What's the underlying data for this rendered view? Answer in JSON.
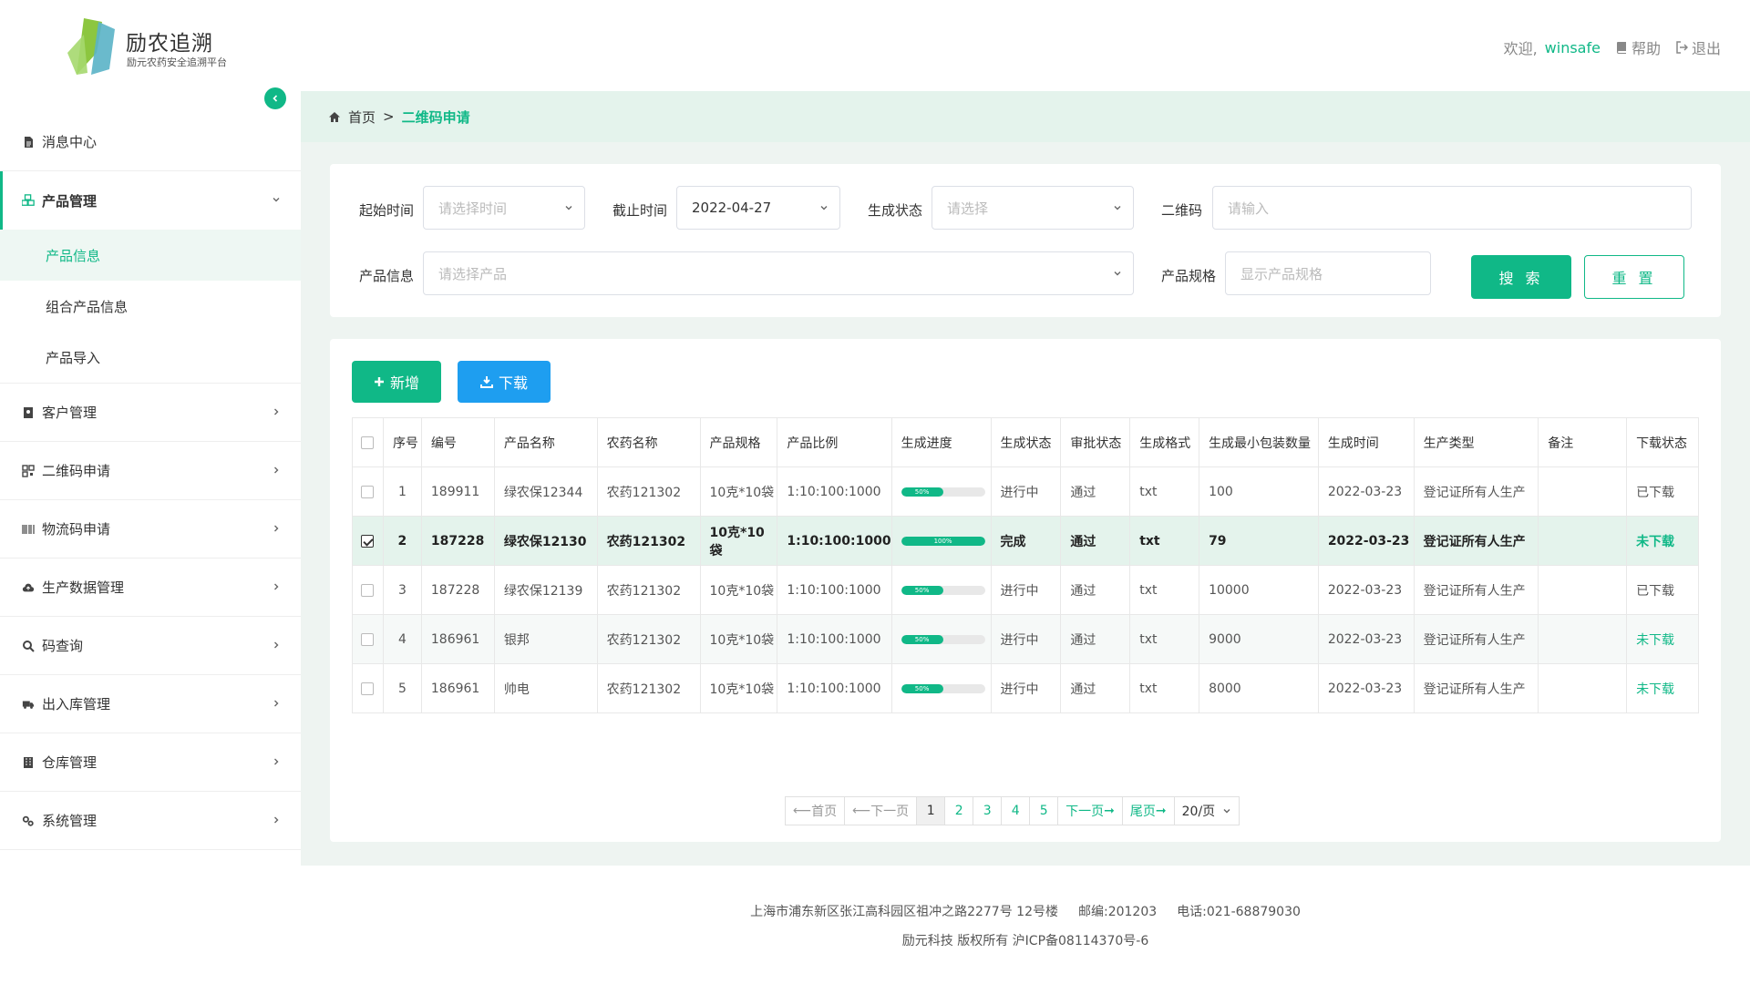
{
  "brand": {
    "title": "励农追溯",
    "subtitle": "励元农药安全追溯平台"
  },
  "header": {
    "welcome": "欢迎,",
    "username": "winsafe",
    "help": "帮助",
    "logout": "退出"
  },
  "sidebar": {
    "items": [
      {
        "label": "消息中心",
        "icon": "document-icon"
      },
      {
        "label": "产品管理",
        "icon": "cubes-icon",
        "expanded": true,
        "children": [
          "产品信息",
          "组合产品信息",
          "产品导入"
        ],
        "active_child": "产品信息"
      },
      {
        "label": "客户管理",
        "icon": "contact-book-icon"
      },
      {
        "label": "二维码申请",
        "icon": "qrcode-icon"
      },
      {
        "label": "物流码申请",
        "icon": "barcode-icon"
      },
      {
        "label": "生产数据管理",
        "icon": "cloud-upload-icon"
      },
      {
        "label": "码查询",
        "icon": "search-icon"
      },
      {
        "label": "出入库管理",
        "icon": "truck-icon"
      },
      {
        "label": "仓库管理",
        "icon": "building-icon"
      },
      {
        "label": "系统管理",
        "icon": "gears-icon"
      }
    ]
  },
  "breadcrumb": {
    "home": "首页",
    "current": "二维码申请"
  },
  "filters": {
    "start_label": "起始时间",
    "start_placeholder": "请选择时间",
    "end_label": "截止时间",
    "end_value": "2022-04-27",
    "status_label": "生成状态",
    "status_placeholder": "请选择",
    "qr_label": "二维码",
    "qr_placeholder": "请输入",
    "product_label": "产品信息",
    "product_placeholder": "请选择产品",
    "spec_label": "产品规格",
    "spec_placeholder": "显示产品规格",
    "search_btn": "搜 索",
    "reset_btn": "重 置"
  },
  "actions": {
    "add": "新增",
    "download": "下载"
  },
  "table": {
    "columns": [
      "序号",
      "编号",
      "产品名称",
      "农药名称",
      "产品规格",
      "产品比例",
      "生成进度",
      "生成状态",
      "审批状态",
      "生成格式",
      "生成最小包装数量",
      "生成时间",
      "生产类型",
      "备注",
      "下载状态"
    ],
    "rows": [
      {
        "idx": "1",
        "code": "189911",
        "product": "绿农保12344",
        "pesticide": "农药121302",
        "spec": "10克*10袋",
        "ratio": "1:10:100:1000",
        "progress": 50,
        "progress_label": "50%",
        "gen_status": "进行中",
        "approval": "通过",
        "format": "txt",
        "min_pack": "100",
        "time": "2022-03-23",
        "type": "登记证所有人生产",
        "remark": "",
        "download": "已下载",
        "checked": false
      },
      {
        "idx": "2",
        "code": "187228",
        "product": "绿农保12130",
        "pesticide": "农药121302",
        "spec": "10克*10袋",
        "ratio": "1:10:100:1000",
        "progress": 100,
        "progress_label": "100%",
        "gen_status": "完成",
        "approval": "通过",
        "format": "txt",
        "min_pack": "79",
        "time": "2022-03-23",
        "type": "登记证所有人生产",
        "remark": "",
        "download": "未下载",
        "checked": true
      },
      {
        "idx": "3",
        "code": "187228",
        "product": "绿农保12139",
        "pesticide": "农药121302",
        "spec": "10克*10袋",
        "ratio": "1:10:100:1000",
        "progress": 50,
        "progress_label": "50%",
        "gen_status": "进行中",
        "approval": "通过",
        "format": "txt",
        "min_pack": "10000",
        "time": "2022-03-23",
        "type": "登记证所有人生产",
        "remark": "",
        "download": "已下载",
        "checked": false
      },
      {
        "idx": "4",
        "code": "186961",
        "product": "银邦",
        "pesticide": "农药121302",
        "spec": "10克*10袋",
        "ratio": "1:10:100:1000",
        "progress": 50,
        "progress_label": "50%",
        "gen_status": "进行中",
        "approval": "通过",
        "format": "txt",
        "min_pack": "9000",
        "time": "2022-03-23",
        "type": "登记证所有人生产",
        "remark": "",
        "download": "未下载",
        "checked": false
      },
      {
        "idx": "5",
        "code": "186961",
        "product": "帅电",
        "pesticide": "农药121302",
        "spec": "10克*10袋",
        "ratio": "1:10:100:1000",
        "progress": 50,
        "progress_label": "50%",
        "gen_status": "进行中",
        "approval": "通过",
        "format": "txt",
        "min_pack": "8000",
        "time": "2022-03-23",
        "type": "登记证所有人生产",
        "remark": "",
        "download": "未下载",
        "checked": false
      }
    ]
  },
  "pager": {
    "first": "首页",
    "prev": "下一页",
    "pages": [
      "1",
      "2",
      "3",
      "4",
      "5"
    ],
    "current": "1",
    "next": "下一页",
    "last": "尾页",
    "page_size": "20/页"
  },
  "footer": {
    "address": "上海市浦东新区张江高科园区祖冲之路2277号 12号楼",
    "postcode": "邮编:201203",
    "phone": "电话:021-68879030",
    "copyright": "励元科技 版权所有 沪ICP备08114370号-6"
  },
  "colors": {
    "accent": "#10b887",
    "blue": "#1e9ef0",
    "breadcrumb_bg": "#e4f3ec",
    "main_bg": "#eef4f1"
  }
}
